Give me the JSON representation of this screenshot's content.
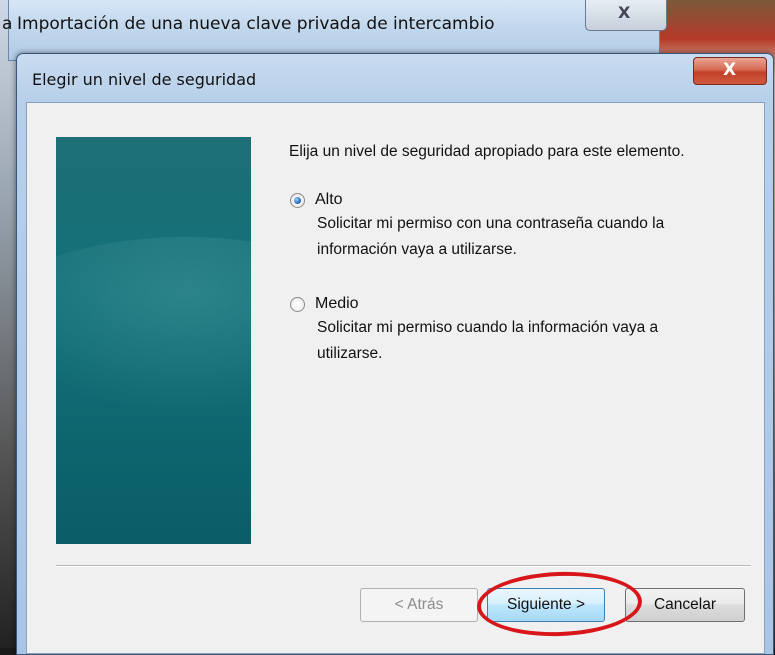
{
  "background_window": {
    "partial_char": "a",
    "title": "Importación de una nueva clave privada de intercambio",
    "close_glyph": "X"
  },
  "dialog": {
    "title": "Elegir un nivel de seguridad",
    "close_glyph": "X",
    "prompt": "Elija un nivel de seguridad apropiado para este elemento.",
    "options": [
      {
        "label": "Alto",
        "checked": true,
        "description": "Solicitar mi permiso con una contraseña cuando la información vaya a utilizarse."
      },
      {
        "label": "Medio",
        "checked": false,
        "description": "Solicitar mi permiso cuando la información vaya a utilizarse."
      }
    ],
    "buttons": {
      "back": "< Atrás",
      "next": "Siguiente >",
      "cancel": "Cancelar"
    },
    "highlight_color": "#d8161a"
  }
}
